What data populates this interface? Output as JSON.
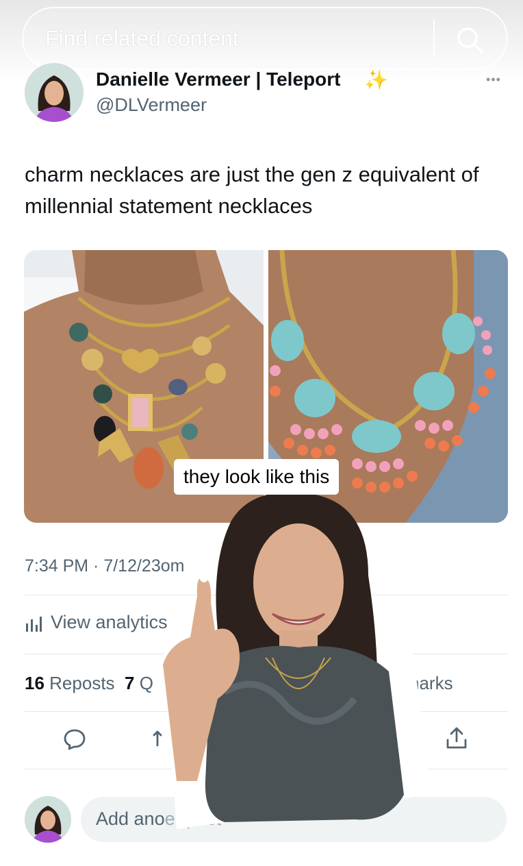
{
  "search": {
    "placeholder": "Find related content"
  },
  "tweet": {
    "author_name": "Danielle Vermeer | Teleport",
    "author_handle": "@DLVermeer",
    "text": "charm necklaces are just the gen z equivalent of millennial statement necklaces",
    "timestamp": "7:34 PM · 7/12/23",
    "timestamp_tail": "om",
    "analytics_label": "View analytics",
    "reposts_count": "16",
    "reposts_label": "Reposts",
    "quotes_count": "7",
    "quotes_label": "Q",
    "bookmarks_partial": "narks"
  },
  "overlay": {
    "caption": "they look like this"
  },
  "reply": {
    "placeholder": "Add ano",
    "placeholder_tail": "er post"
  },
  "colors": {
    "muted": "#536471",
    "divider": "#e1e8ed",
    "reply_bg": "#eff3f4",
    "turquoise": "#7cc6c9",
    "coral": "#ee7b4f"
  },
  "icons": {
    "search": "search-icon",
    "more": "more-icon",
    "analytics": "analytics-icon",
    "reply": "reply-icon",
    "repost": "repost-icon",
    "share": "share-icon",
    "sparkle": "sparkle-icon"
  }
}
